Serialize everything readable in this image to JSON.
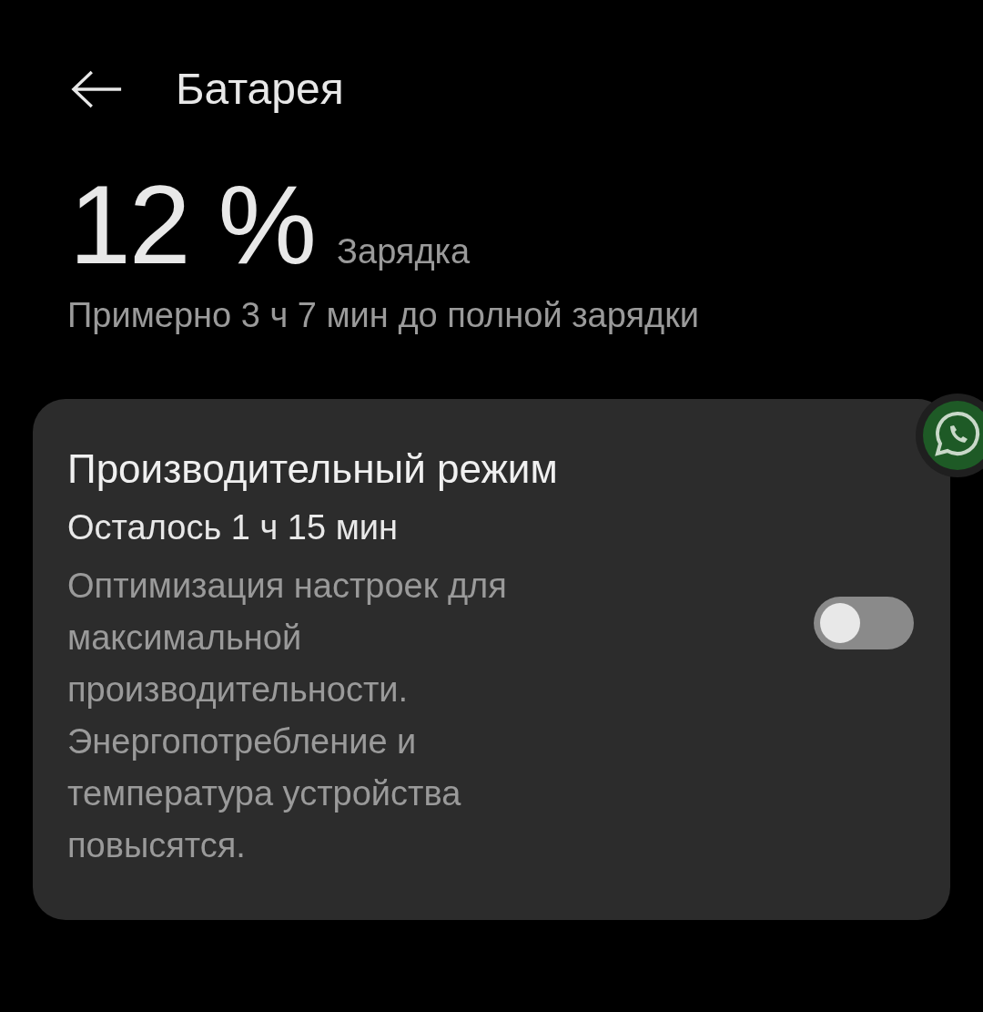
{
  "header": {
    "title": "Батарея"
  },
  "battery": {
    "percent": "12 %",
    "status": "Зарядка",
    "estimate": "Примерно 3 ч 7 мин до полной зарядки"
  },
  "performance_mode": {
    "title": "Производительный режим",
    "remaining": "Осталось 1 ч 15 мин",
    "description": "Оптимизация настроек для максимальной производительности. Энергопотребление и температура устройства повысятся.",
    "on": false
  }
}
